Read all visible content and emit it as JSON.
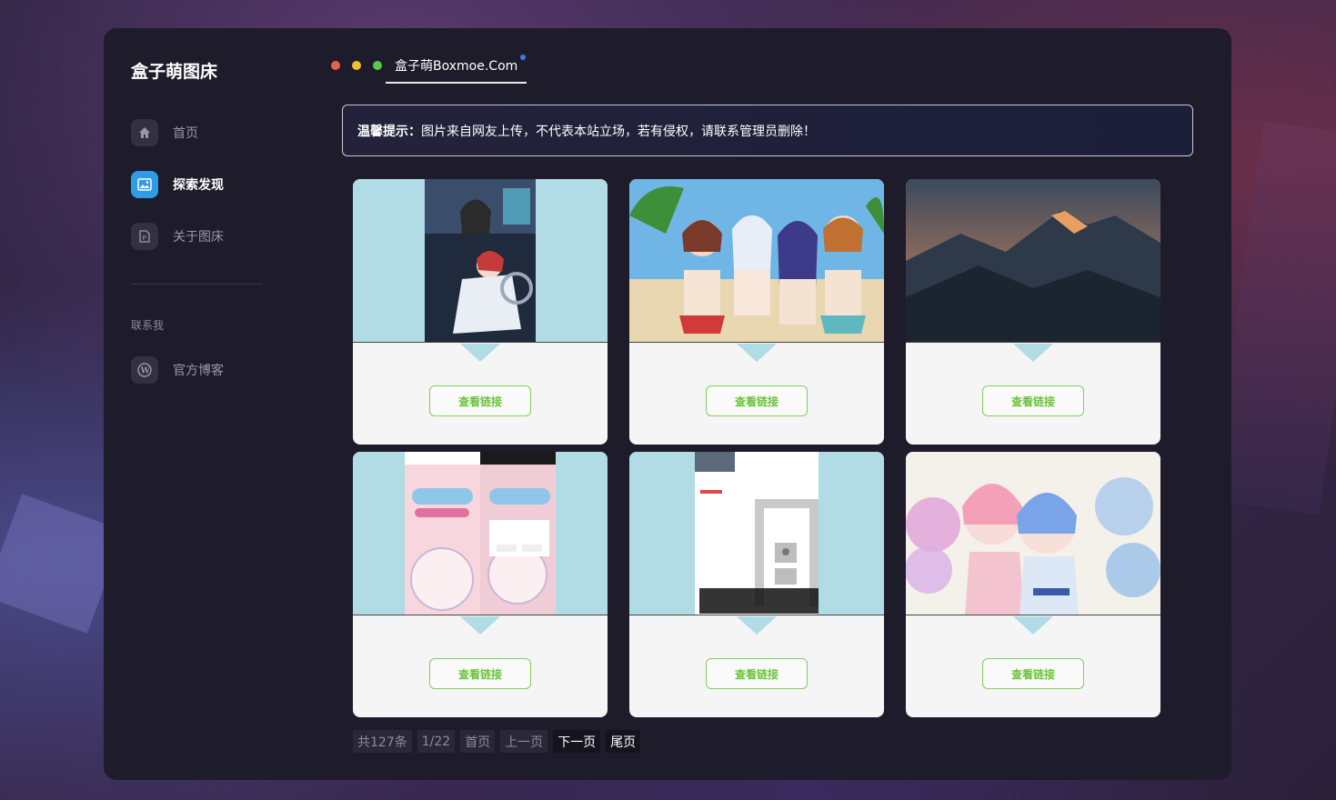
{
  "sidebar": {
    "brand": "盒子萌图床",
    "items": [
      {
        "label": "首页",
        "icon": "home-icon"
      },
      {
        "label": "探索发现",
        "icon": "image-icon",
        "active": true
      },
      {
        "label": "关于图床",
        "icon": "document-icon"
      }
    ],
    "section_label": "联系我",
    "contact": {
      "label": "官方博客",
      "icon": "wordpress-icon"
    }
  },
  "header": {
    "dots": [
      "#ec5f57",
      "#f3be32",
      "#5bc84a"
    ],
    "tab_label": "盒子萌Boxmoe.Com"
  },
  "notice": {
    "prefix": "温馨提示：",
    "text": "图片来自网友上传，不代表本站立场，若有侵权，请联系管理员删除！"
  },
  "cards": [
    {
      "image": "anime-girls-portrait",
      "button": "查看链接"
    },
    {
      "image": "anime-girls-beach",
      "button": "查看链接"
    },
    {
      "image": "mountain-sunset",
      "button": "查看链接"
    },
    {
      "image": "phone-app-screenshots",
      "button": "查看链接"
    },
    {
      "image": "app-screenshot",
      "button": "查看链接"
    },
    {
      "image": "anime-girls-flowers",
      "button": "查看链接"
    }
  ],
  "pagination": {
    "total": "共127条",
    "page": "1/22",
    "first": "首页",
    "prev": "上一页",
    "next": "下一页",
    "last": "尾页"
  },
  "colors": {
    "accent": "#2e9de6",
    "button_green": "#6cc43a",
    "thumb_bg": "#b1dbe5",
    "panel": "#1e1c2b"
  }
}
